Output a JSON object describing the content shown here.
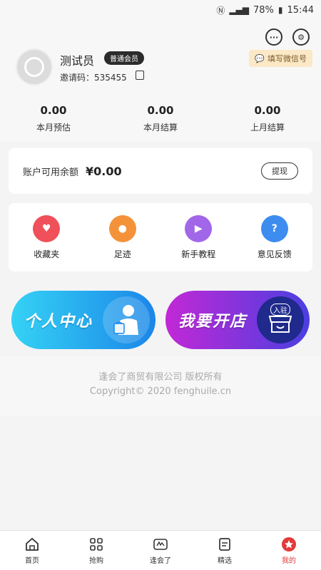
{
  "status_bar": {
    "battery": "78%",
    "time": "15:44"
  },
  "header": {
    "username": "测试员",
    "member_badge": "普通会员",
    "invite_code": "邀请码：535455",
    "wechat_button": "填写微信号"
  },
  "stats": [
    {
      "value": "0.00",
      "label": "本月预估"
    },
    {
      "value": "0.00",
      "label": "本月结算"
    },
    {
      "value": "0.00",
      "label": "上月结算"
    }
  ],
  "balance": {
    "label": "账户可用余额",
    "value": "¥0.00",
    "withdraw": "提现"
  },
  "shortcuts": [
    {
      "label": "收藏夹",
      "icon": "heart-icon",
      "color": "#f0505a"
    },
    {
      "label": "足迹",
      "icon": "footprint-icon",
      "color": "#f4923a"
    },
    {
      "label": "新手教程",
      "icon": "video-icon",
      "color": "#a167e8"
    },
    {
      "label": "意见反馈",
      "icon": "question-icon",
      "color": "#3d8cf0"
    }
  ],
  "banners": {
    "personal": "个人中心",
    "shop": "我要开店",
    "shop_badge": "入驻"
  },
  "copyright": {
    "line1": "逢会了商贸有限公司  版权所有",
    "line2": "Copyright© 2020 fenghuile.cn"
  },
  "tabs": [
    {
      "label": "首页",
      "icon": "home-icon"
    },
    {
      "label": "抢购",
      "icon": "grid-icon"
    },
    {
      "label": "逢会了",
      "icon": "logo-icon"
    },
    {
      "label": "精选",
      "icon": "document-icon"
    },
    {
      "label": "我的",
      "icon": "star-icon",
      "active": true
    }
  ],
  "colors": {
    "accent": "#e23a3a",
    "badge_bg": "#2b2b2b",
    "wechat_bg": "#fbe8c6"
  }
}
